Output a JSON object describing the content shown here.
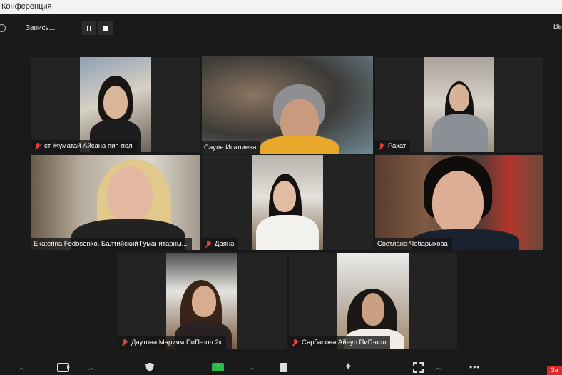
{
  "window": {
    "title": "Конференция"
  },
  "recording": {
    "label": "Запись...",
    "exit_label": "Вы"
  },
  "participants": [
    {
      "name": "ст Жуматай Айсана пип-пол",
      "muted": true
    },
    {
      "name": "Сауле Исалиева",
      "muted": false,
      "active_speaker": true
    },
    {
      "name": "Рахат",
      "muted": true
    },
    {
      "name": "Ekaterina Fedosenko, Балтийский Гуманитарны...",
      "muted": false
    },
    {
      "name": "Даяна",
      "muted": true
    },
    {
      "name": "Светлана Чебарыкова",
      "muted": false
    },
    {
      "name": "Даутова Мариям ПиП-пол 2к",
      "muted": true
    },
    {
      "name": "Сарбасова Айнур ПиП-пол",
      "muted": true
    }
  ],
  "toolbar": {
    "icons": [
      "caret-up",
      "video-camera",
      "caret-up",
      "shield-security",
      "share-screen",
      "caret-up",
      "document-notes",
      "ai-sparkle",
      "frame-capture",
      "caret-up",
      "more-dots"
    ],
    "end_label": "За"
  },
  "colors": {
    "active_border": "#b5e24a",
    "muted": "#e03e3e",
    "share": "#2db84b",
    "end": "#e02828"
  }
}
